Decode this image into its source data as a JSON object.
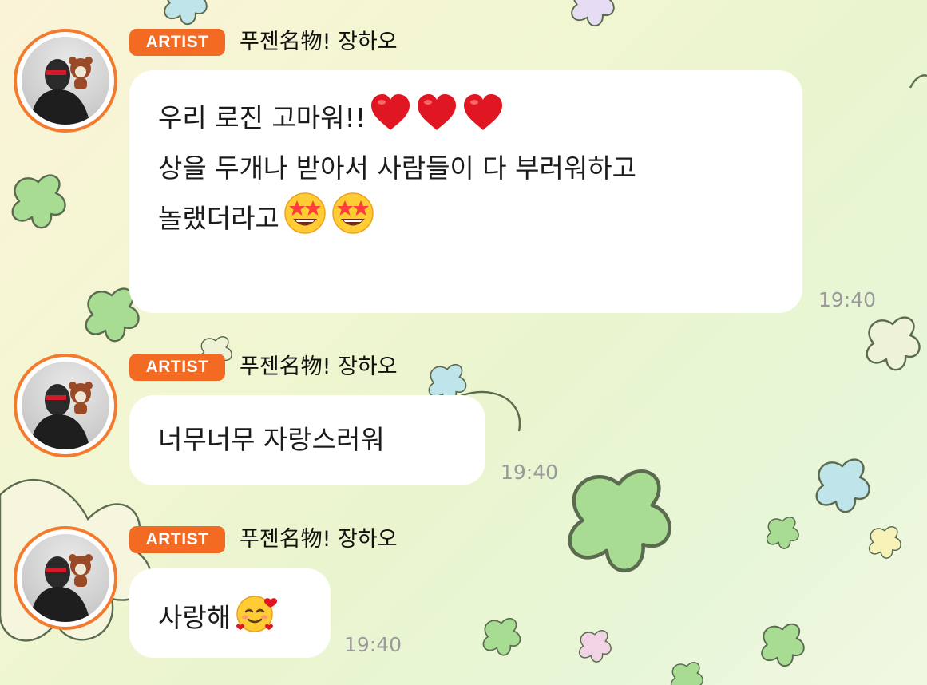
{
  "messages": [
    {
      "badge": "ARTIST",
      "sender": "푸젠名物!  장하오",
      "lines": [
        "우리 로진 고마워!!",
        "상을 두개나 받아서 사람들이 다 부러워하고",
        "놀랬더라고"
      ],
      "emojis_line1": [
        "heart-emoji",
        "heart-emoji",
        "heart-emoji"
      ],
      "emojis_line3": [
        "star-struck-emoji",
        "star-struck-emoji"
      ],
      "time": "19:40"
    },
    {
      "badge": "ARTIST",
      "sender": "푸젠名物!  장하오",
      "lines": [
        "너무너무 자랑스러워"
      ],
      "time": "19:40"
    },
    {
      "badge": "ARTIST",
      "sender": "푸젠名物!  장하오",
      "lines": [
        "사랑해"
      ],
      "emojis_line1": [
        "smiling-face-with-hearts-emoji"
      ],
      "time": "19:40"
    }
  ],
  "colors": {
    "badge": "#f36b22",
    "avatar_ring": "#f47a2d",
    "bubble": "#ffffff",
    "timestamp": "#9a9a9a",
    "background_clover_green": "#a8dc93",
    "background_clover_blue": "#bfe5ea",
    "background_clover_pink": "#f2d3e6"
  }
}
